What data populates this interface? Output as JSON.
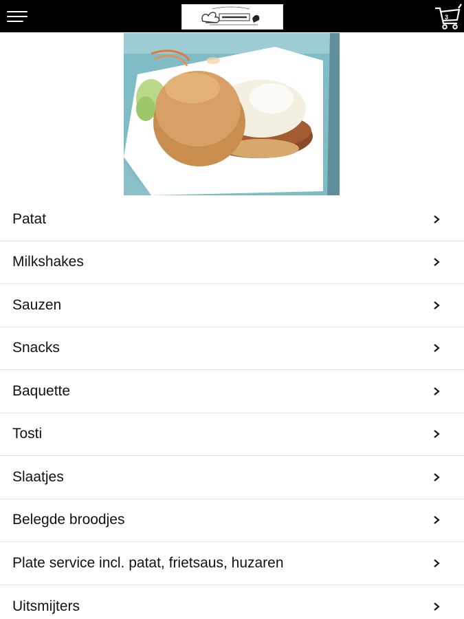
{
  "header": {
    "menu_icon": "hamburger-menu-icon",
    "cart_icon": "shopping-cart-icon",
    "cart_count": "3"
  },
  "hero": {
    "image": "burger-photo"
  },
  "categories": [
    {
      "label": "Patat"
    },
    {
      "label": "Milkshakes"
    },
    {
      "label": "Sauzen"
    },
    {
      "label": "Snacks"
    },
    {
      "label": "Baquette"
    },
    {
      "label": "Tosti"
    },
    {
      "label": "Slaatjes"
    },
    {
      "label": "Belegde broodjes"
    },
    {
      "label": "Plate service incl. patat, frietsaus, huzaren"
    },
    {
      "label": "Uitsmijters"
    }
  ],
  "colors": {
    "topbar": "#000000",
    "background": "#ffffff",
    "divider": "#e3e3e3",
    "text": "#111111"
  }
}
